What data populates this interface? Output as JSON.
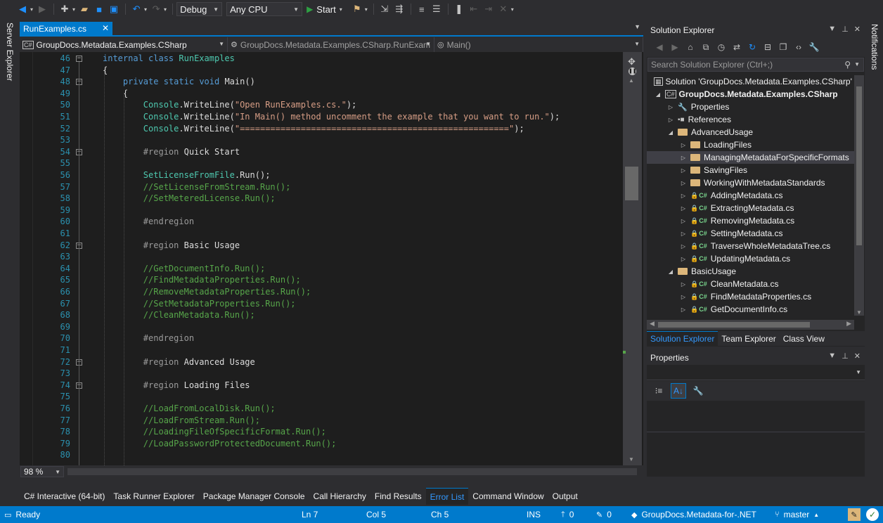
{
  "toolbar": {
    "config": "Debug",
    "platform": "Any CPU",
    "start_label": "Start"
  },
  "side_tabs": {
    "left": "Server Explorer",
    "right": "Notifications"
  },
  "editor": {
    "tab_name": "RunExamples.cs",
    "nav": {
      "project": "GroupDocs.Metadata.Examples.CSharp",
      "class": "GroupDocs.Metadata.Examples.CSharp.RunExam",
      "member": "Main()"
    },
    "zoom": "98 %",
    "lines": [
      {
        "n": "46",
        "html": "<span class=\"kw\">internal</span> <span class=\"kw\">class</span> <span class=\"ty\">RunExamples</span>"
      },
      {
        "n": "47",
        "html": "{"
      },
      {
        "n": "48",
        "html": "    <span class=\"kw\">private</span> <span class=\"kw\">static</span> <span class=\"kw\">void</span> Main()"
      },
      {
        "n": "49",
        "html": "    {"
      },
      {
        "n": "50",
        "html": "        <span class=\"ty\">Console</span>.WriteLine(<span class=\"str\">\"Open RunExamples.cs.\"</span>);"
      },
      {
        "n": "51",
        "html": "        <span class=\"ty\">Console</span>.WriteLine(<span class=\"str\">\"In Main() method uncomment the example that you want to run.\"</span>);"
      },
      {
        "n": "52",
        "html": "        <span class=\"ty\">Console</span>.WriteLine(<span class=\"str\">\"=====================================================\"</span>);"
      },
      {
        "n": "53",
        "html": ""
      },
      {
        "n": "54",
        "html": "        <span class=\"reg\">#region</span> Quick Start"
      },
      {
        "n": "55",
        "html": ""
      },
      {
        "n": "56",
        "html": "        <span class=\"ty\">SetLicenseFromFile</span>.Run();"
      },
      {
        "n": "57",
        "html": "        <span class=\"com\">//SetLicenseFromStream.Run();</span>"
      },
      {
        "n": "58",
        "html": "        <span class=\"com\">//SetMeteredLicense.Run();</span>"
      },
      {
        "n": "59",
        "html": ""
      },
      {
        "n": "60",
        "html": "        <span class=\"reg\">#endregion</span>"
      },
      {
        "n": "61",
        "html": ""
      },
      {
        "n": "62",
        "html": "        <span class=\"reg\">#region</span> Basic Usage"
      },
      {
        "n": "63",
        "html": ""
      },
      {
        "n": "64",
        "html": "        <span class=\"com\">//GetDocumentInfo.Run();</span>"
      },
      {
        "n": "65",
        "html": "        <span class=\"com\">//FindMetadataProperties.Run();</span>"
      },
      {
        "n": "66",
        "html": "        <span class=\"com\">//RemoveMetadataProperties.Run();</span>"
      },
      {
        "n": "67",
        "html": "        <span class=\"com\">//SetMetadataProperties.Run();</span>"
      },
      {
        "n": "68",
        "html": "        <span class=\"com\">//CleanMetadata.Run();</span>"
      },
      {
        "n": "69",
        "html": ""
      },
      {
        "n": "70",
        "html": "        <span class=\"reg\">#endregion</span>"
      },
      {
        "n": "71",
        "html": ""
      },
      {
        "n": "72",
        "html": "        <span class=\"reg\">#region</span> Advanced Usage"
      },
      {
        "n": "73",
        "html": ""
      },
      {
        "n": "74",
        "html": "        <span class=\"reg\">#region</span> Loading Files"
      },
      {
        "n": "75",
        "html": ""
      },
      {
        "n": "76",
        "html": "        <span class=\"com\">//LoadFromLocalDisk.Run();</span>"
      },
      {
        "n": "77",
        "html": "        <span class=\"com\">//LoadFromStream.Run();</span>"
      },
      {
        "n": "78",
        "html": "        <span class=\"com\">//LoadingFileOfSpecificFormat.Run();</span>"
      },
      {
        "n": "79",
        "html": "        <span class=\"com\">//LoadPasswordProtectedDocument.Run();</span>"
      },
      {
        "n": "80",
        "html": ""
      }
    ]
  },
  "solution_explorer": {
    "title": "Solution Explorer",
    "search_placeholder": "Search Solution Explorer (Ctrl+;)",
    "solution": "Solution 'GroupDocs.Metadata.Examples.CSharp'",
    "project": "GroupDocs.Metadata.Examples.CSharp",
    "properties": "Properties",
    "references": "References",
    "advanced": "AdvancedUsage",
    "loading_files": "LoadingFiles",
    "managing": "ManagingMetadataForSpecificFormats",
    "saving_files": "SavingFiles",
    "working_std": "WorkingWithMetadataStandards",
    "adding": "AddingMetadata.cs",
    "extracting": "ExtractingMetadata.cs",
    "removing": "RemovingMetadata.cs",
    "setting": "SettingMetadata.cs",
    "traverse": "TraverseWholeMetadataTree.cs",
    "updating": "UpdatingMetadata.cs",
    "basic": "BasicUsage",
    "clean": "CleanMetadata.cs",
    "find_props": "FindMetadataProperties.cs",
    "get_doc_info": "GetDocumentInfo.cs",
    "tabs": [
      "Solution Explorer",
      "Team Explorer",
      "Class View"
    ]
  },
  "properties_panel": {
    "title": "Properties"
  },
  "bottom_tabs": [
    "C# Interactive (64-bit)",
    "Task Runner Explorer",
    "Package Manager Console",
    "Call Hierarchy",
    "Find Results",
    "Error List",
    "Command Window",
    "Output"
  ],
  "status": {
    "ready": "Ready",
    "ln": "Ln 7",
    "col": "Col 5",
    "ch": "Ch 5",
    "ins": "INS",
    "up_count": "0",
    "edit_count": "0",
    "repo": "GroupDocs.Metadata-for-.NET",
    "branch": "master"
  }
}
